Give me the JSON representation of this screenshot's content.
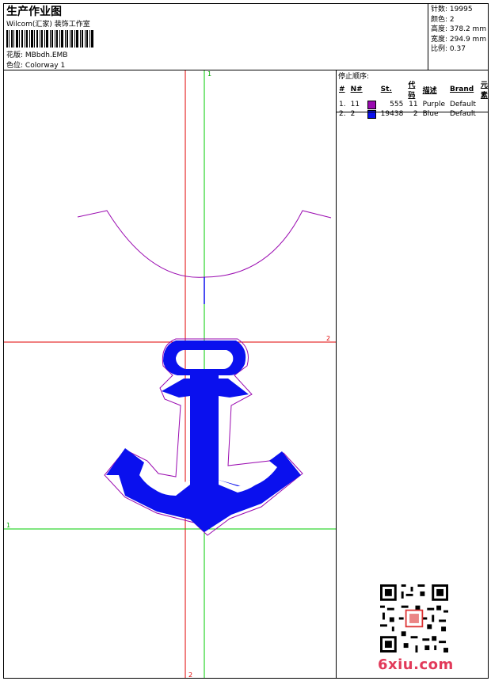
{
  "header": {
    "title": "生产作业图",
    "subtitle": "Wilcom(汇家) 装饰工作室",
    "design_label": "花版:",
    "design_value": "MBbdh.EMB",
    "colorway_label": "色位:",
    "colorway_value": "Colorway 1"
  },
  "stats": [
    {
      "label": "针数:",
      "value": "19995"
    },
    {
      "label": "颜色:",
      "value": "2"
    },
    {
      "label": "高度:",
      "value": "378.2 mm"
    },
    {
      "label": "宽度:",
      "value": "294.9 mm"
    },
    {
      "label": "比例:",
      "value": "0.37"
    }
  ],
  "stop_sequence": {
    "title": "停止顺序:",
    "columns": [
      "#",
      "N#",
      "St.",
      "代码",
      "描述",
      "Brand",
      "元素"
    ],
    "rows": [
      {
        "idx": "1.",
        "n": "11",
        "color": "#9a0ab0",
        "stitches": "555",
        "code": "11",
        "desc": "Purple",
        "brand": "Default"
      },
      {
        "idx": "2.",
        "n": "2",
        "color": "#0a10ee",
        "stitches": "19438",
        "code": "2",
        "desc": "Blue",
        "brand": "Default"
      }
    ]
  },
  "guides": {
    "green_vertical_label": "1",
    "green_horizontal_label": "1",
    "red_vertical_label": "2",
    "red_horizontal_label": "2"
  },
  "colors": {
    "outline": "#9a0ab0",
    "fill": "#0a10ee",
    "guide_green": "#00cc00",
    "guide_red": "#e00000"
  },
  "watermark": {
    "site": "6xiu.com"
  }
}
